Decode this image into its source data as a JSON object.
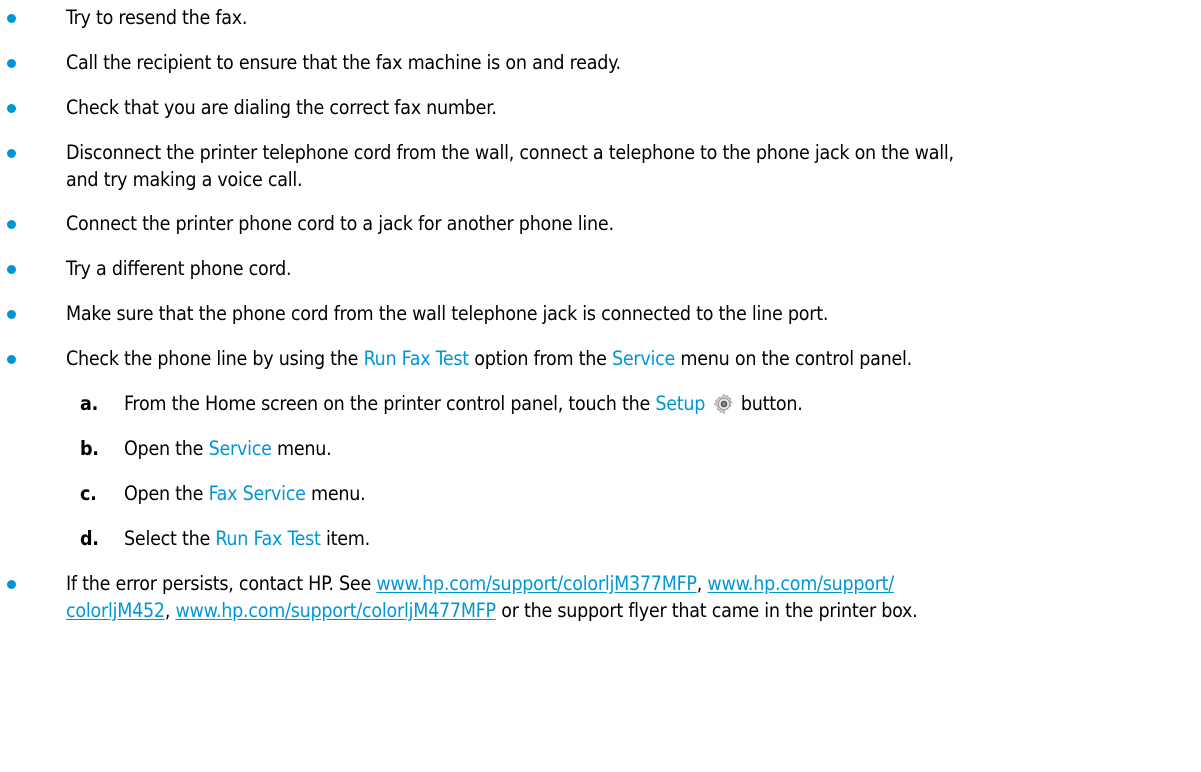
{
  "bullets": [
    {
      "text": "Try to resend the fax."
    },
    {
      "text": "Call the recipient to ensure that the fax machine is on and ready."
    },
    {
      "text": "Check that you are dialing the correct fax number."
    },
    {
      "line1": "Disconnect the printer telephone cord from the wall, connect a telephone to the phone jack on the wall,",
      "line2": "and try making a voice call."
    },
    {
      "text": "Connect the printer phone cord to a jack for another phone line."
    },
    {
      "text": "Try a different phone cord."
    },
    {
      "text": "Make sure that the phone cord from the wall telephone jack is connected to the line port."
    },
    {
      "pre": "Check the phone line by using the ",
      "hl1": "Run Fax Test",
      "mid": " option from the ",
      "hl2": "Service",
      "post": " menu on the control panel."
    }
  ],
  "steps": [
    {
      "letter": "a.",
      "pre": "From the Home screen on the printer control panel, touch the ",
      "hl": "Setup",
      "post": " button.",
      "icon": "setup-gear-icon"
    },
    {
      "letter": "b.",
      "pre": "Open the ",
      "hl": "Service",
      "post": " menu."
    },
    {
      "letter": "c.",
      "pre": "Open the ",
      "hl": "Fax Service",
      "post": " menu."
    },
    {
      "letter": "d.",
      "pre": "Select the ",
      "hl": "Run Fax Test",
      "post": " item."
    }
  ],
  "last_bullet": {
    "pre": "If the error persists, contact HP. See ",
    "link1": "www.hp.com/support/colorljM377MFP",
    "sep1": ", ",
    "link2a": "www.hp.com/support/",
    "link2b": "colorljM452",
    "sep2": ", ",
    "link3": "www.hp.com/support/colorljM477MFP",
    "post": " or the support flyer that came in the printer box."
  },
  "colors": {
    "accent": "#0096d6",
    "text": "#000000",
    "background": "#ffffff"
  }
}
